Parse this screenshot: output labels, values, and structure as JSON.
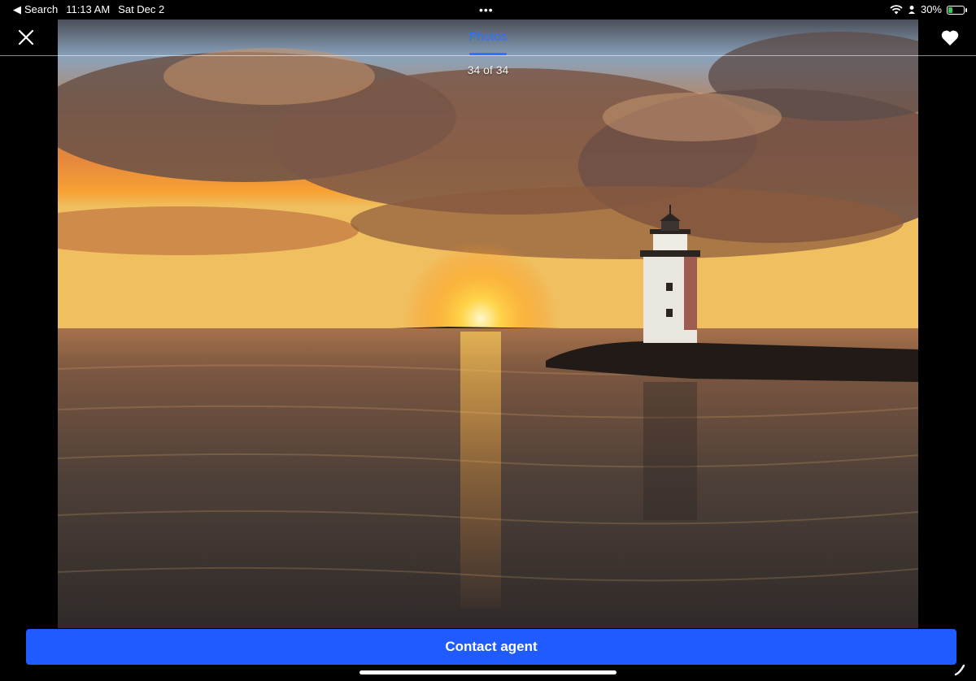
{
  "status_bar": {
    "back_label": "Search",
    "time": "11:13 AM",
    "date": "Sat Dec 2",
    "battery": "30%",
    "battery_level": 0.3,
    "icons": [
      "wifi-icon",
      "location-icon",
      "battery-charging-icon"
    ]
  },
  "header": {
    "close_icon": "close-icon",
    "tab_label": "Photos",
    "favorite_icon": "heart-icon",
    "accent_color": "#2a73ff"
  },
  "gallery": {
    "counter": "34 of 34",
    "current": 34,
    "total": 34
  },
  "cta": {
    "label": "Contact agent",
    "color": "#1f5bff"
  }
}
